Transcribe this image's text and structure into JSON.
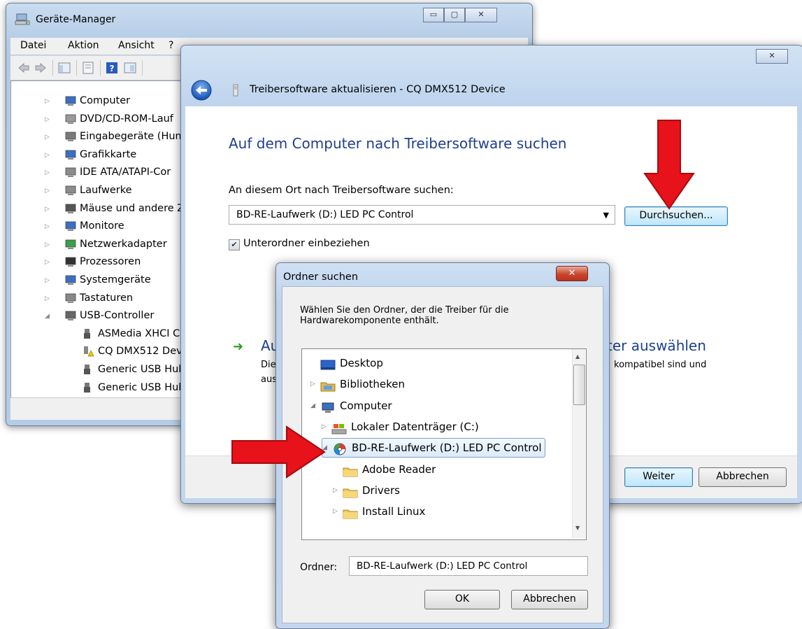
{
  "device_manager": {
    "title": "Geräte-Manager",
    "caption_buttons": {
      "minimize": "▭",
      "maximize": "▢",
      "close": "✕"
    },
    "menu": [
      "Datei",
      "Aktion",
      "Ansicht",
      "?"
    ],
    "tree": [
      {
        "label": "Computer",
        "expander": "▷"
      },
      {
        "label": "DVD/CD-ROM-Lauf",
        "expander": "▷"
      },
      {
        "label": "Eingabegeräte (Hum",
        "expander": "▷"
      },
      {
        "label": "Grafikkarte",
        "expander": "▷"
      },
      {
        "label": "IDE ATA/ATAPI-Cor",
        "expander": "▷"
      },
      {
        "label": "Laufwerke",
        "expander": "▷"
      },
      {
        "label": "Mäuse und andere Z",
        "expander": "▷"
      },
      {
        "label": "Monitore",
        "expander": "▷"
      },
      {
        "label": "Netzwerkadapter",
        "expander": "▷"
      },
      {
        "label": "Prozessoren",
        "expander": "▷"
      },
      {
        "label": "Systemgeräte",
        "expander": "▷"
      },
      {
        "label": "Tastaturen",
        "expander": "▷"
      },
      {
        "label": "USB-Controller",
        "expander": "◢"
      }
    ],
    "usb_children": [
      "ASMedia XHCI C",
      "CQ DMX512 Dev",
      "Generic USB Hub",
      "Generic USB Hub"
    ]
  },
  "wizard": {
    "close_label": "✕",
    "back_icon": "back-arrow-icon",
    "title": "Treibersoftware aktualisieren - CQ DMX512 Device",
    "heading": "Auf dem Computer nach Treibersoftware suchen",
    "location_label": "An diesem Ort nach Treibersoftware suchen:",
    "location_value": "BD-RE-Laufwerk (D:) LED PC Control",
    "browse_label": "Durchsuchen...",
    "include_subfolders": "Unterordner einbeziehen",
    "include_subfolders_checked": true,
    "option_title_start": "Au",
    "option_title_end": "ter auswählen",
    "option_desc_1_start": "Die",
    "option_desc_1_end": "kompatibel sind und",
    "option_desc_2_start": "aus",
    "next_label": "Weiter",
    "cancel_label": "Abbrechen"
  },
  "folder_dialog": {
    "title": "Ordner suchen",
    "close_label": "✕",
    "instruction": "Wählen Sie den Ordner, der die Treiber für die Hardwarekomponente enthält.",
    "tree": [
      {
        "label": "Desktop"
      },
      {
        "label": "Bibliotheken"
      },
      {
        "label": "Computer"
      },
      {
        "label": "Lokaler Datenträger (C:)"
      },
      {
        "label": "BD-RE-Laufwerk (D:) LED PC Control"
      },
      {
        "label": "Adobe Reader"
      },
      {
        "label": "Drivers"
      },
      {
        "label": "Install Linux"
      }
    ],
    "folder_label": "Ordner:",
    "folder_value": "BD-RE-Laufwerk (D:) LED PC Control",
    "ok_label": "OK",
    "cancel_label": "Abbrechen"
  },
  "colors": {
    "heading_blue": "#1e3f8f",
    "annotation_red": "#e8121a",
    "selection_border": "#7da2ce"
  }
}
